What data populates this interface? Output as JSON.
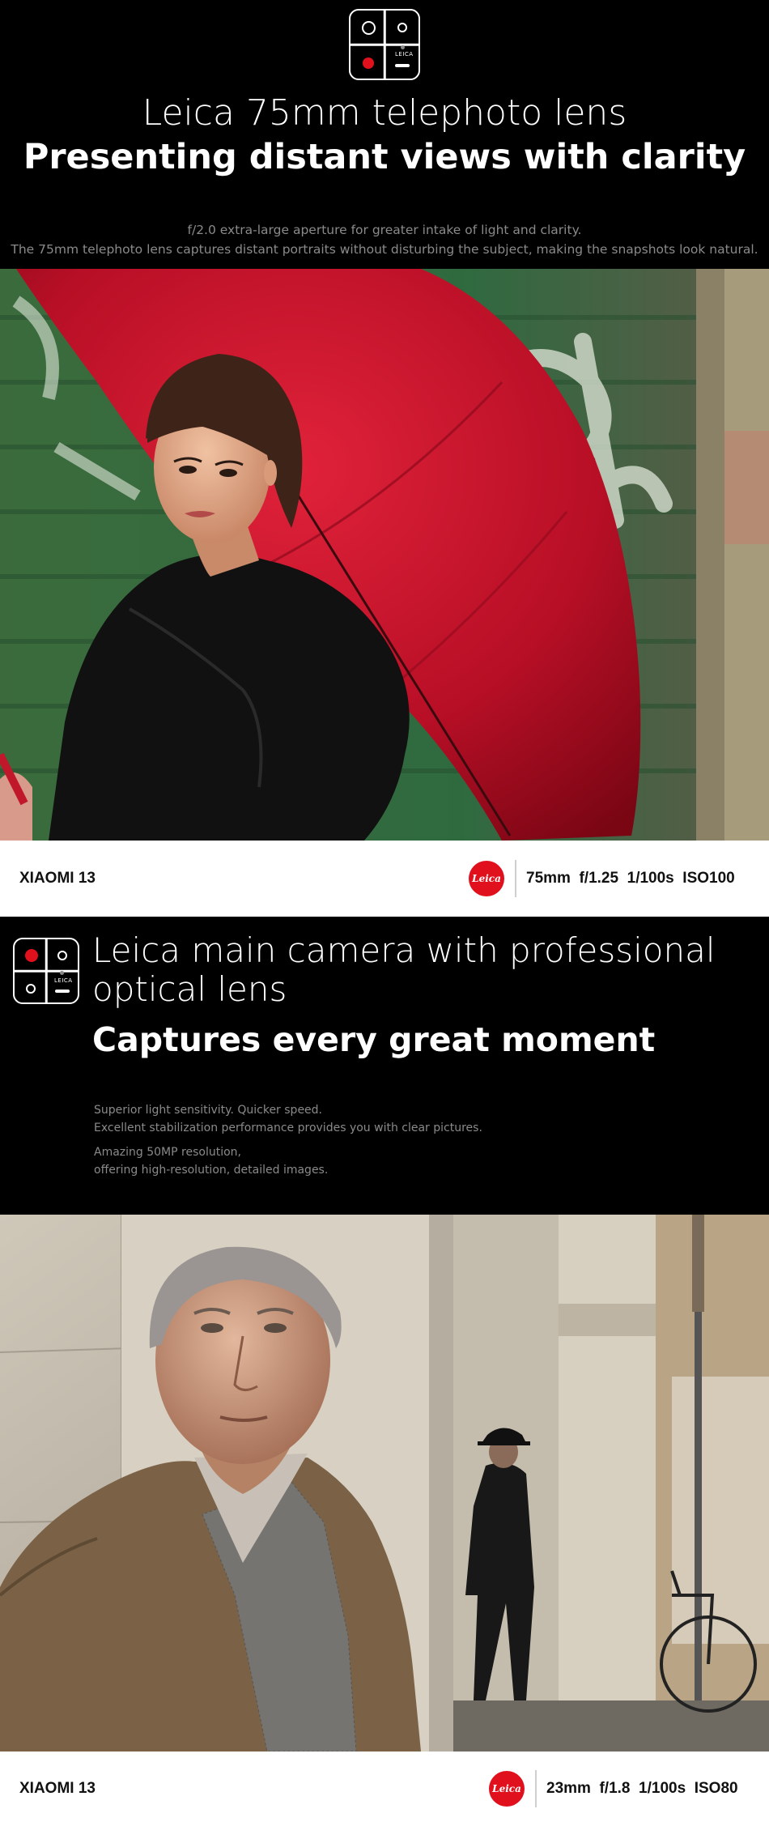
{
  "section1": {
    "title_light": "Leica 75mm telephoto lens",
    "title_bold": "Presenting distant views with clarity",
    "desc_line1": "f/2.0 extra-large aperture for greater intake of light and clarity.",
    "desc_line2": "The 75mm telephoto lens captures distant portraits without disturbing the subject, making the snapshots look natural.",
    "photo_alt": "Woman with red umbrella against green shutter",
    "caption": {
      "brand": "XIAOMI 13",
      "badge": "Leica",
      "specs": "75mm  f/1.25  1/100s  ISO100"
    }
  },
  "section2": {
    "title_light": "Leica main camera with professional optical lens",
    "title_bold": "Captures every great moment",
    "para1_line1": "Superior light sensitivity. Quicker speed.",
    "para1_line2": "Excellent stabilization performance provides you with clear pictures.",
    "para2_line1": "Amazing 50MP resolution,",
    "para2_line2": "offering high-resolution, detailed images.",
    "photo_alt": "Older man looking up beside stone columns, pedestrian in hat walking by",
    "caption": {
      "brand": "XIAOMI 13",
      "badge": "Leica",
      "specs": "23mm  f/1.8  1/100s  ISO80"
    }
  },
  "icon_text": "LEICA",
  "colors": {
    "background": "#000000",
    "accent_red": "#e0101c",
    "caption_bg": "#ffffff",
    "muted_text": "#8a8a8a"
  }
}
